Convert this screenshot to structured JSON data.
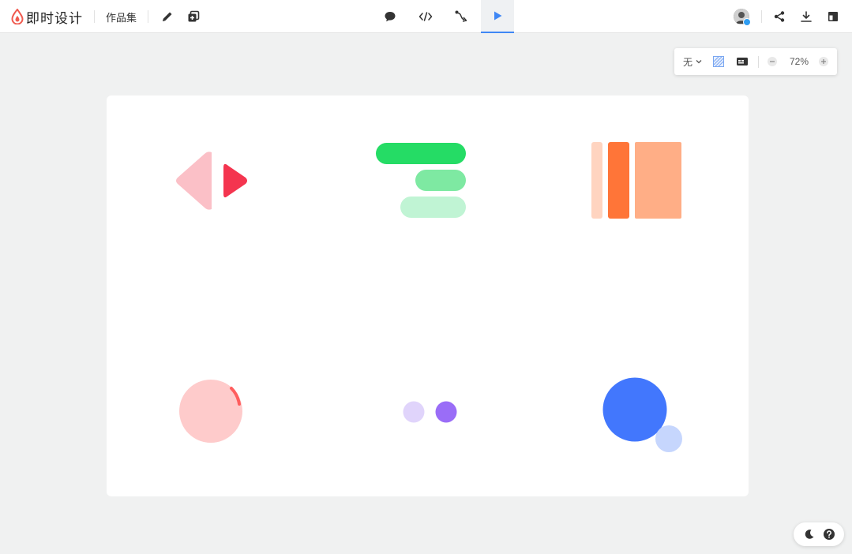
{
  "header": {
    "brand_name": "即时设计",
    "works_label": "作品集",
    "brand_color": "#f05a4f",
    "active_tool": "play"
  },
  "zoom_panel": {
    "background_mode": "无",
    "zoom_level": "72%"
  },
  "colors": {
    "accent": "#3f87f5",
    "red_dark": "#f4354f",
    "red_light": "#fbc0c7",
    "green_dark": "#25dc65",
    "green_mid": "#7ee9a2",
    "green_light": "#c0f4d4",
    "orange_dark": "#ff7538",
    "orange_mid": "#ffae86",
    "orange_light": "#ffd4c0",
    "pink_circle": "#fecbcb",
    "pink_arc": "#ff5e5e",
    "purple_dark": "#9a6df7",
    "purple_light": "#e0d4fb",
    "blue_dark": "#4277fd",
    "blue_light": "#c6d6fd"
  }
}
